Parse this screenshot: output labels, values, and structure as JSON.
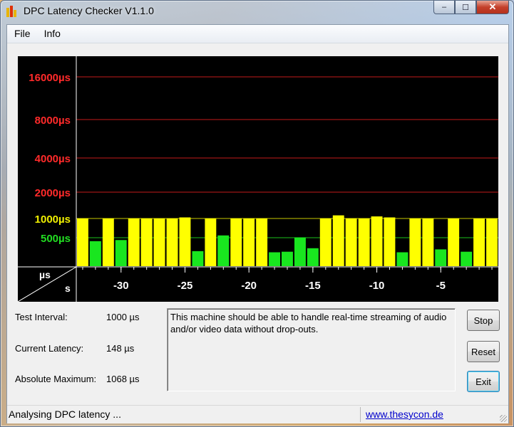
{
  "window": {
    "title": "DPC Latency Checker V1.1.0",
    "caption_buttons": {
      "minimize": "–",
      "maximize": "☐",
      "close": "✕"
    }
  },
  "menu": [
    "File",
    "Info"
  ],
  "graph": {
    "y_unit": "µs",
    "x_unit": "s",
    "y_levels": [
      {
        "label": "16000µs",
        "color": "#ff2a2a"
      },
      {
        "label": "8000µs",
        "color": "#ff2a2a"
      },
      {
        "label": "4000µs",
        "color": "#ff2a2a"
      },
      {
        "label": "2000µs",
        "color": "#ff2a2a"
      },
      {
        "label": "1000µs",
        "color": "#f0f000"
      },
      {
        "label": "500µs",
        "color": "#22dd22"
      }
    ],
    "x_ticks": [
      "-30",
      "-25",
      "-20",
      "-15",
      "-10",
      "-5"
    ],
    "colors": {
      "yellow": "#ffff00",
      "green": "#19e61f",
      "red_line": "#c41a1a"
    }
  },
  "chart_data": {
    "type": "bar",
    "title": "",
    "xlabel": "s",
    "ylabel": "µs",
    "y_scale": "log2",
    "y_ticks": [
      500,
      1000,
      2000,
      4000,
      8000,
      16000
    ],
    "x_ticks": [
      -30,
      -25,
      -20,
      -15,
      -10,
      -5
    ],
    "x": [
      -33,
      -32,
      -31,
      -30,
      -29,
      -28,
      -27,
      -26,
      -25,
      -24,
      -23,
      -22,
      -21,
      -20,
      -19,
      -18,
      -17,
      -16,
      -15,
      -14,
      -13,
      -12,
      -11,
      -10,
      -9,
      -8,
      -7,
      -6,
      -5,
      -4,
      -3,
      -2,
      -1
    ],
    "values": [
      1000,
      440,
      1000,
      460,
      1000,
      1000,
      1000,
      1000,
      1020,
      270,
      1000,
      560,
      1000,
      1000,
      1000,
      250,
      260,
      510,
      320,
      1000,
      1060,
      1000,
      1000,
      1040,
      1020,
      250,
      1000,
      1000,
      300,
      1000,
      260,
      1000,
      1000
    ]
  },
  "info": {
    "test_interval_label": "Test Interval:",
    "test_interval_value": "1000 µs",
    "current_latency_label": "Current Latency:",
    "current_latency_value": "148 µs",
    "absolute_maximum_label": "Absolute Maximum:",
    "absolute_maximum_value": "1068 µs"
  },
  "message": "This machine should be able to handle real-time streaming of audio and/or video data without drop-outs.",
  "buttons": {
    "stop": "Stop",
    "reset": "Reset",
    "exit": "Exit"
  },
  "status": {
    "text": "Analysing DPC latency ...",
    "link": "www.thesycon.de"
  }
}
